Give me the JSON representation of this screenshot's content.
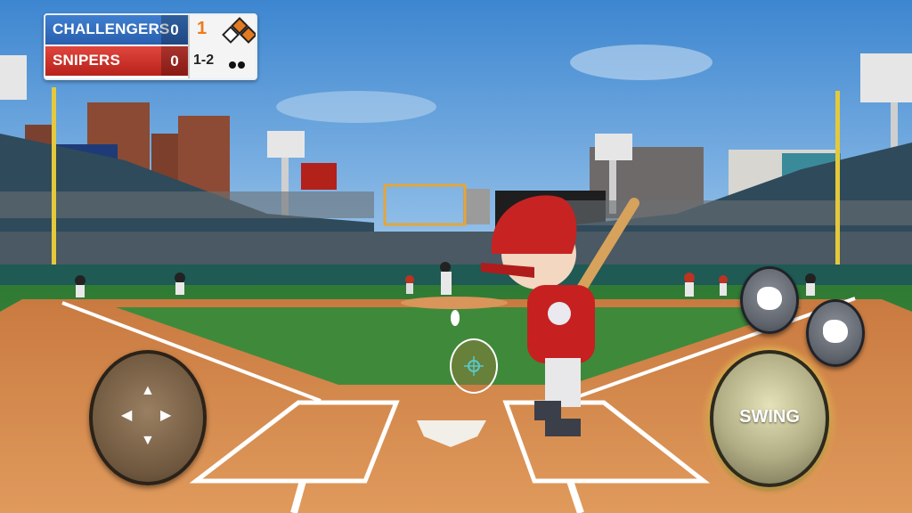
{
  "scoreboard": {
    "teams": [
      {
        "name": "CHALLENGERS",
        "score": "0",
        "color": "#2f6ec0"
      },
      {
        "name": "SNIPERS",
        "score": "0",
        "color": "#c52a22"
      }
    ],
    "inning": "1",
    "inning_half": "top",
    "bases_occupied": {
      "first": true,
      "second": true,
      "third": false
    },
    "count": "1-2",
    "outs": 2
  },
  "controls": {
    "joystick_icon": "dpad-arrows-icon",
    "swing_label": "SWING",
    "bunt_icon": "glove-icon",
    "steal_icon": "glove-icon"
  },
  "colors": {
    "sky": "#6aa6d8",
    "grass": "#3f8a3a",
    "infield_dirt": "#d7894c",
    "swing_glow": "#f7e35a"
  }
}
